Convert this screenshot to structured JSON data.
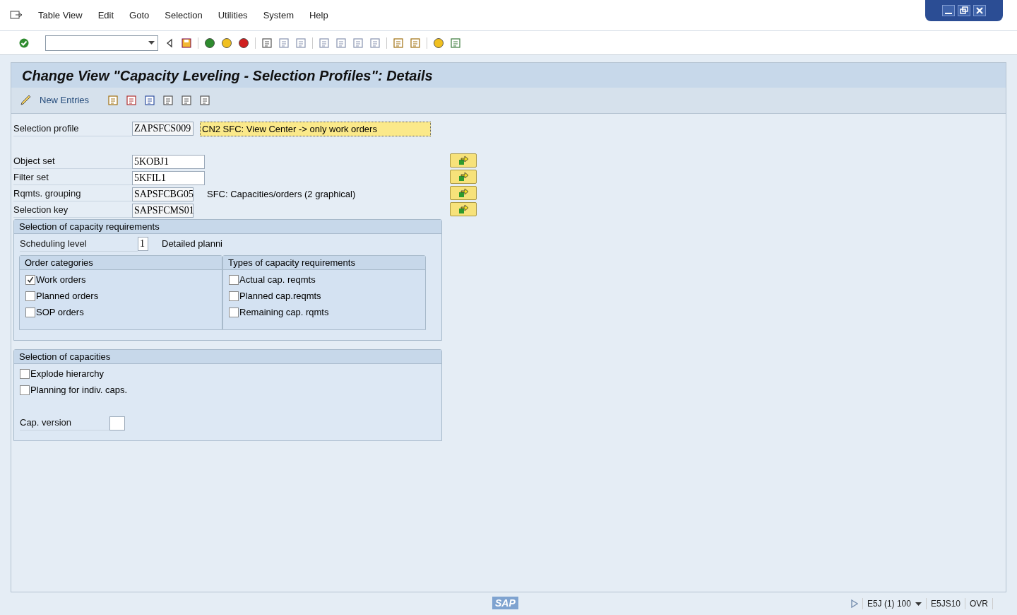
{
  "menu_bar": {
    "items": [
      "Table View",
      "Edit",
      "Goto",
      "Selection",
      "Utilities",
      "System",
      "Help"
    ]
  },
  "title": "Change View \"Capacity Leveling - Selection Profiles\": Details",
  "app_toolbar": {
    "new_entries": "New Entries"
  },
  "selection_profile": {
    "label": "Selection profile",
    "value": "ZAPSFCS009",
    "description": "CN2 SFC: View Center -> only work orders"
  },
  "fields": [
    {
      "label": "Object set",
      "value": "5KOBJ1",
      "editable": true
    },
    {
      "label": "Filter set",
      "value": "5KFIL1",
      "editable": true
    },
    {
      "label": "Rqmts. grouping",
      "value": "SAPSFCBG05",
      "description": "SFC: Capacities/orders (2 graphical)",
      "editable": false
    },
    {
      "label": "Selection key",
      "value": "SAPSFCMS01",
      "editable": false
    }
  ],
  "requirements": {
    "title": "Selection of capacity requirements",
    "scheduling_label": "Scheduling level",
    "scheduling_value": "1",
    "scheduling_text": "Detailed planni",
    "groups": [
      {
        "title": "Order categories",
        "items": [
          {
            "label": "Work orders",
            "checked": true
          },
          {
            "label": "Planned orders",
            "checked": false
          },
          {
            "label": "SOP orders",
            "checked": false
          }
        ]
      },
      {
        "title": "Types of capacity requirements",
        "items": [
          {
            "label": "Actual cap. reqmts",
            "checked": false
          },
          {
            "label": "Planned cap.reqmts",
            "checked": false
          },
          {
            "label": "Remaining cap. rqmts",
            "checked": false
          }
        ]
      }
    ]
  },
  "capacities": {
    "title": "Selection of capacities",
    "items": [
      {
        "label": "Explode hierarchy",
        "checked": false
      },
      {
        "label": "Planning for indiv. caps.",
        "checked": false
      }
    ],
    "version_label": "Cap. version"
  },
  "status_bar": {
    "logo": "SAP",
    "system": "E5J (1) 100",
    "server": "E5JS10",
    "mode": "OVR"
  }
}
